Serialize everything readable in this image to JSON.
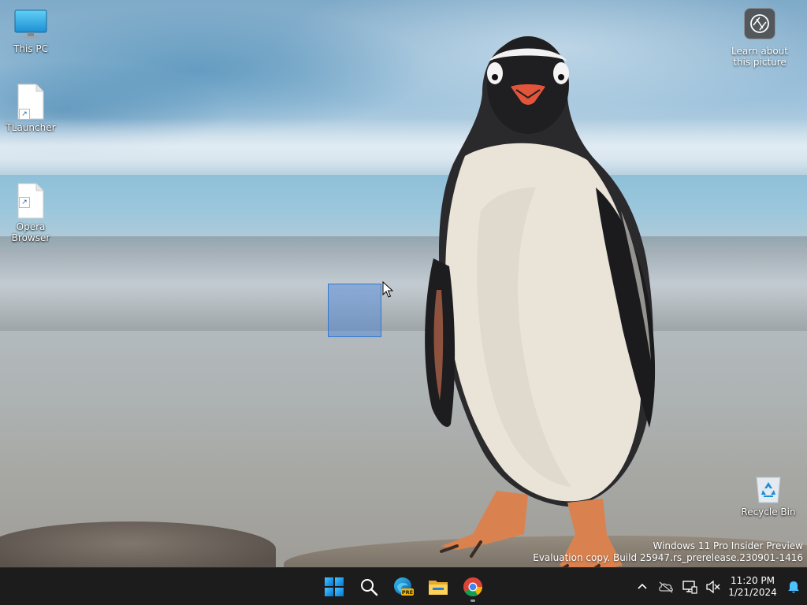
{
  "desktop": {
    "icons": [
      {
        "label": "This PC",
        "icon": "monitor-icon"
      },
      {
        "label": "TLauncher",
        "icon": "file-shortcut-icon"
      },
      {
        "label": "Opera\nBrowser",
        "icon": "file-shortcut-icon"
      },
      {
        "label": "Recycle Bin",
        "icon": "recycle-bin-icon"
      }
    ],
    "learn_about": {
      "label_line1": "Learn about",
      "label_line2": "this picture",
      "icon": "camera-lens-icon"
    },
    "watermark": {
      "line1": "Windows 11 Pro Insider Preview",
      "line2": "Evaluation copy. Build 25947.rs_prerelease.230901-1416"
    }
  },
  "taskbar": {
    "apps": [
      {
        "name": "Start",
        "icon": "windows-logo-icon"
      },
      {
        "name": "Search",
        "icon": "search-icon"
      },
      {
        "name": "Microsoft Edge",
        "icon": "edge-pre-icon",
        "badge": "PRE"
      },
      {
        "name": "File Explorer",
        "icon": "folder-icon"
      },
      {
        "name": "Google Chrome",
        "icon": "chrome-icon",
        "running": true
      }
    ],
    "tray": {
      "icons": [
        "chevron-up-icon",
        "onedrive-icon",
        "network-icon",
        "volume-muted-icon"
      ],
      "time": "11:20 PM",
      "date": "1/21/2024",
      "notification_icon": "bell-icon"
    }
  },
  "colors": {
    "taskbar_bg": "#1c1c1c",
    "selection_fill": "#4682dc",
    "accent_blue": "#0a84ff"
  }
}
